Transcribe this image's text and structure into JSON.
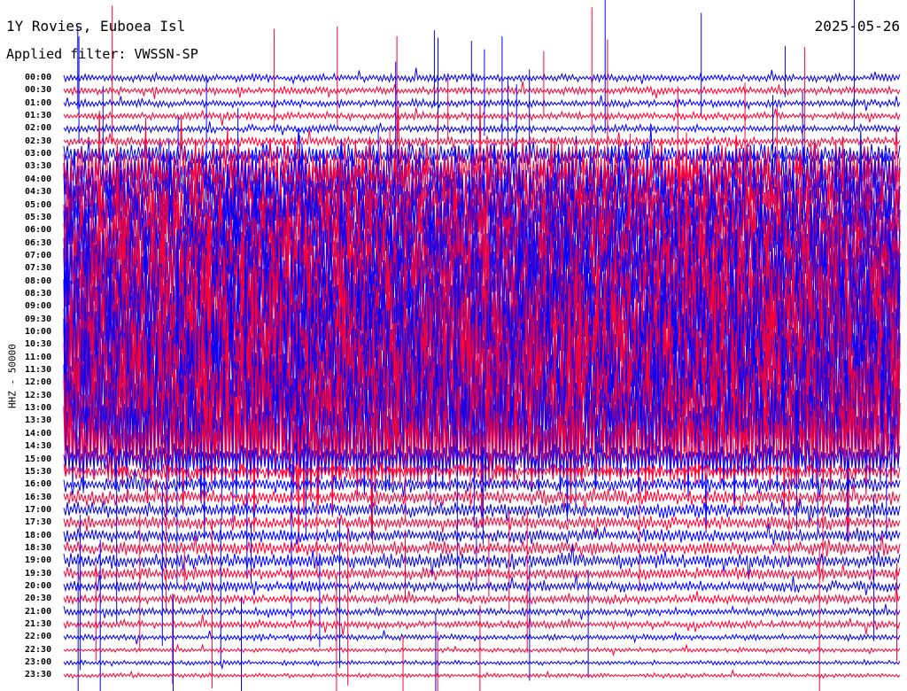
{
  "header": {
    "station": "1Y Rovies, Euboea Isl",
    "date": "2025-05-26",
    "filter": "Applied filter: VWSSN-SP"
  },
  "chart_data": {
    "type": "line",
    "title": "1Y Rovies, Euboea Isl",
    "date": "2025-05-26",
    "ylabel": "HHZ - 50000",
    "row_labels": [
      "00:00",
      "00:30",
      "01:00",
      "01:30",
      "02:00",
      "02:30",
      "03:00",
      "03:30",
      "04:00",
      "04:30",
      "05:00",
      "05:30",
      "06:00",
      "06:30",
      "07:00",
      "07:30",
      "08:00",
      "08:30",
      "09:00",
      "09:30",
      "10:00",
      "10:30",
      "11:00",
      "11:30",
      "12:00",
      "12:30",
      "13:00",
      "13:30",
      "14:00",
      "14:30",
      "15:00",
      "15:30",
      "16:00",
      "16:30",
      "17:00",
      "17:30",
      "18:00",
      "18:30",
      "19:00",
      "19:30",
      "20:00",
      "20:30",
      "21:00",
      "21:30",
      "22:00",
      "22:30",
      "23:00",
      "23:30"
    ],
    "row_amplitudes": [
      5,
      5,
      5,
      5,
      5,
      6,
      16,
      35,
      45,
      50,
      55,
      60,
      65,
      68,
      70,
      72,
      74,
      76,
      78,
      80,
      80,
      80,
      82,
      84,
      86,
      86,
      84,
      82,
      80,
      60,
      20,
      10,
      10,
      10,
      10,
      9,
      9,
      9,
      10,
      8,
      7,
      6,
      5,
      5,
      4,
      3,
      3,
      3
    ],
    "trace_colors": [
      "#0000ff",
      "#ff0033"
    ]
  }
}
